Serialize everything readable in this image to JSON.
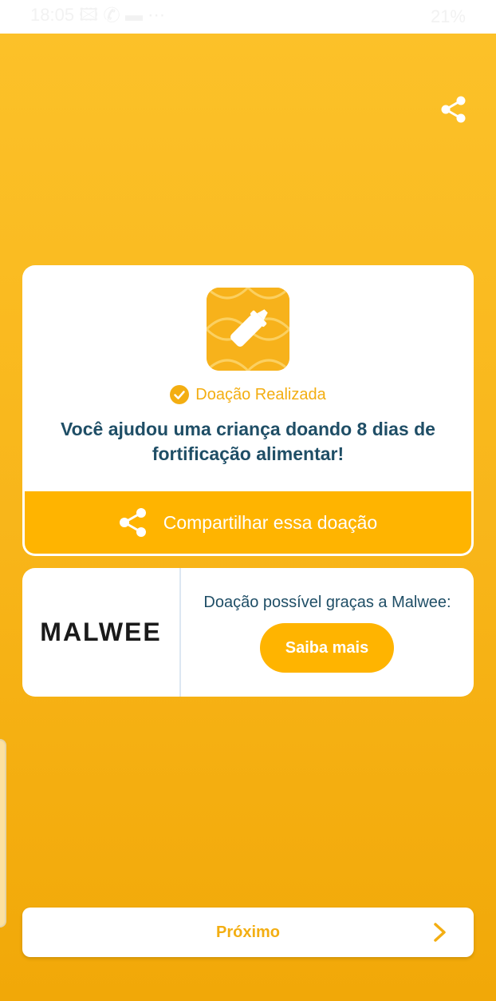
{
  "status_bar": {
    "time": "18:05",
    "icons": "🖾 ✆ ▬  ⋯",
    "battery": "21%"
  },
  "top": {
    "share_icon": "share-icon"
  },
  "donation_card": {
    "image_icon": "baby-bottle-icon",
    "status_icon": "check-circle-icon",
    "status_label": "Doação Realizada",
    "message": "Você ajudou uma criança doando 8 dias de fortificação alimentar!"
  },
  "share_button": {
    "icon": "share-icon",
    "label": "Compartilhar essa doação"
  },
  "sponsor": {
    "logo_text": "MALWEE",
    "text": "Doação possível graças a Malwee:",
    "button_label": "Saiba mais"
  },
  "next_button": {
    "label": "Próximo",
    "icon": "chevron-right-icon"
  },
  "colors": {
    "accent": "#FFB400",
    "text_dark": "#1F4E66",
    "background": "#F8B519"
  }
}
